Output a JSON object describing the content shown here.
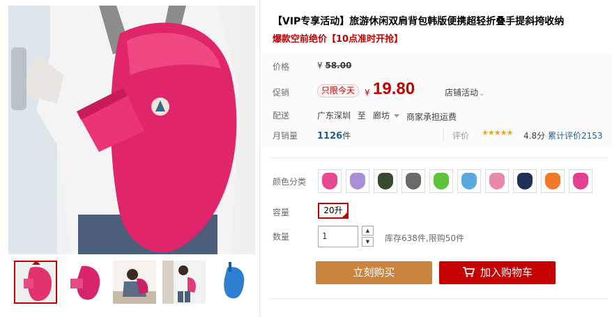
{
  "product": {
    "title": "【VIP专享活动】旅游休闲双肩背包韩版便携超轻折叠手提斜挎收纳",
    "subtitle": "爆款空前绝价【10点准时开抢】"
  },
  "pricing": {
    "price_label": "价格",
    "original_price": "58.00",
    "currency": "¥",
    "promo_label": "促销",
    "promo_badge": "只限今天",
    "promo_price": "19.80",
    "store_promo": "店铺活动"
  },
  "shipping": {
    "label": "配送",
    "from": "广东深圳",
    "to_word": "至",
    "to": "廊坊",
    "fee": "商家承担运费"
  },
  "sales": {
    "label": "月销量",
    "count": "1126",
    "unit": "件",
    "rating_label": "评价",
    "stars": "★★★★★",
    "score": "4.8分",
    "reviews": "累计评价2153"
  },
  "options": {
    "color_label": "颜色分类",
    "colors": [
      "#e8488f",
      "#a98fd6",
      "#3a4a2e",
      "#6a6a6a",
      "#5dc33a",
      "#5aa8e0",
      "#e889ab",
      "#1f2f58",
      "#f07a2a",
      "#e2408f"
    ],
    "capacity_label": "容量",
    "capacity_value": "20升",
    "quantity_label": "数量",
    "quantity_value": "1",
    "qty_up": "▲",
    "qty_down": "▼",
    "stock": "库存638件,限购50件"
  },
  "actions": {
    "buy_now": "立刻购买",
    "add_to_cart": "加入购物车"
  },
  "gallery": {
    "thumb_colors": [
      "#e3306f",
      "#d8246a",
      "#c9205f",
      "#e23a78",
      "#2f7fd1"
    ],
    "brand_color": "#c40000"
  }
}
